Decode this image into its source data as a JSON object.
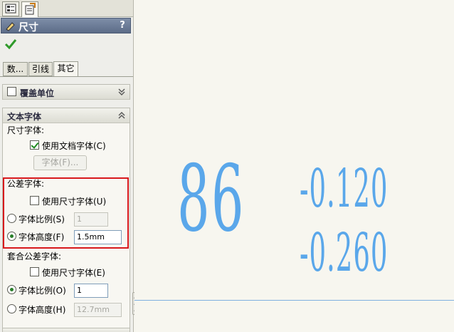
{
  "panel": {
    "title": "尺寸",
    "help": "?",
    "subtabs": [
      "数...",
      "引线",
      "其它"
    ],
    "override_units": {
      "title": "覆盖单位"
    },
    "text_font": {
      "title": "文本字体",
      "dimension_font_label": "尺寸字体:",
      "use_doc_font": "使用文档字体(C)",
      "font_button": "字体(F)...",
      "tolerance_font_label": "公差字体:",
      "use_dim_font": "使用尺寸字体(U)",
      "font_scale": "字体比例(S)",
      "font_scale_value": "1",
      "font_height": "字体高度(F)",
      "font_height_value": "1.5mm",
      "fit_tolerance_font_label": "套合公差字体:",
      "fit_use_dim_font": "使用尺寸字体(E)",
      "fit_font_scale": "字体比例(O)",
      "fit_font_scale_value": "1",
      "fit_font_height": "字体高度(H)",
      "fit_font_height_value": "12.7mm"
    }
  },
  "viewport": {
    "dimension_value": "86",
    "upper_tolerance": "-0.120",
    "lower_tolerance": "-0.260"
  },
  "colors": {
    "accent_red": "#d8181c",
    "dimension_blue": "#5aa7ea",
    "title_bar": "#6a7a96"
  },
  "icons": [
    "feature-tree-icon",
    "property-manager-icon",
    "dimension-icon",
    "ok-checkmark-icon",
    "collapse-icon",
    "expand-icon"
  ]
}
